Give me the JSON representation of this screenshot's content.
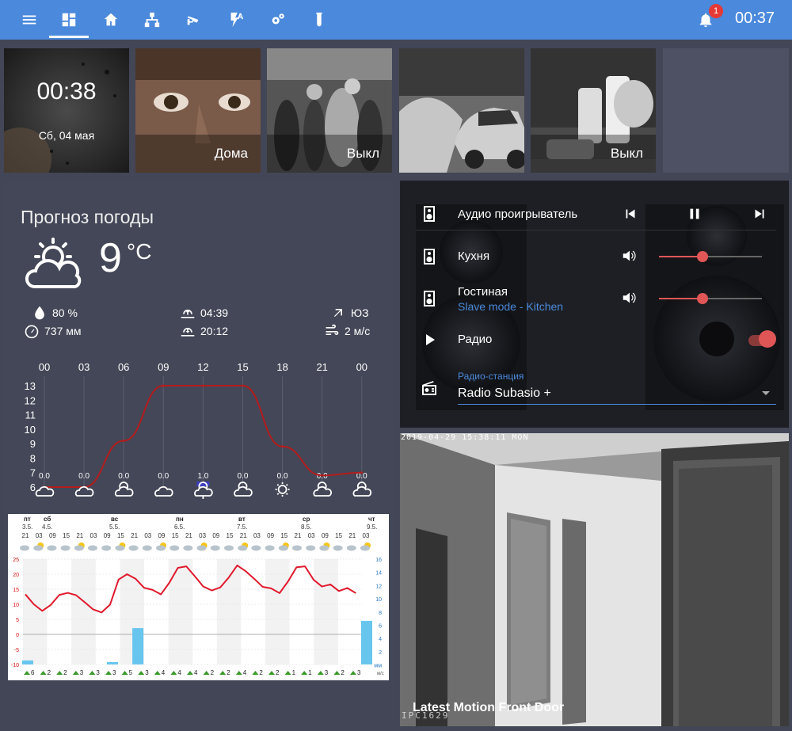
{
  "topbar": {
    "icons": [
      "menu-icon",
      "dashboard-icon",
      "home-icon",
      "network-icon",
      "cctv-icon",
      "flash-auto-icon",
      "settings-icon",
      "test-tube-icon"
    ],
    "notification_count": "1",
    "time": "00:37"
  },
  "tiles": [
    {
      "time": "00:38",
      "date": "Сб, 04 мая"
    },
    {
      "caption": "Дома"
    },
    {
      "caption": "Выкл"
    },
    {
      "caption": ""
    },
    {
      "caption": "Выкл"
    }
  ],
  "weather": {
    "title": "Прогноз погоды",
    "temp": "9",
    "unit": "°C",
    "humidity": "80 %",
    "pressure": "737 мм",
    "sunrise": "04:39",
    "sunset": "20:12",
    "wind_dir": "ЮЗ",
    "wind_speed": "2 м/с",
    "hours": [
      "00",
      "03",
      "06",
      "09",
      "12",
      "15",
      "18",
      "21",
      "00"
    ],
    "y_ticks": [
      "13",
      "12",
      "11",
      "10",
      "9",
      "8",
      "7",
      "6"
    ],
    "precip": [
      "0.0",
      "0.0",
      "0.0",
      "0.0",
      "1.0",
      "0.0",
      "0.0",
      "0.0",
      "0.0"
    ],
    "forecast_icons": [
      "cloudy-icon",
      "cloudy-icon",
      "partly-cloudy-icon",
      "cloudy-icon",
      "rain-icon",
      "partly-cloudy-icon",
      "sunny-icon",
      "partly-cloudy-icon",
      "partly-cloudy-icon"
    ]
  },
  "chart_data": {
    "type": "line",
    "x": [
      "00",
      "03",
      "06",
      "09",
      "12",
      "15",
      "18",
      "21",
      "00"
    ],
    "series": [
      {
        "values": [
          6,
          6,
          9.2,
          13,
          13,
          13,
          8.8,
          6.8,
          7
        ]
      }
    ],
    "bars": [
      0,
      0,
      0,
      0,
      1.0,
      0,
      0,
      0,
      0
    ],
    "ylim": [
      6,
      13
    ],
    "grid": true
  },
  "meteogram": {
    "days": [
      "пт",
      "сб",
      "вс",
      "пн",
      "вт",
      "ср",
      "чт"
    ],
    "dates": [
      "3.5.",
      "4.5.",
      "5.5.",
      "6.5.",
      "7.5.",
      "8.5.",
      "9.5."
    ],
    "hours": [
      "21",
      "03",
      "09",
      "15",
      "21",
      "03",
      "09",
      "15",
      "21",
      "03",
      "09",
      "15",
      "21",
      "03",
      "09",
      "15",
      "21",
      "03",
      "09",
      "15",
      "21",
      "03",
      "09",
      "15",
      "21",
      "03"
    ],
    "left_ticks": [
      "25",
      "20",
      "15",
      "10",
      "5",
      "0",
      "-5",
      "-10"
    ],
    "right_ticks": [
      "16",
      "14",
      "12",
      "10",
      "8",
      "6",
      "4",
      "2",
      "мм"
    ],
    "winds": [
      "6",
      "2",
      "2",
      "3",
      "3",
      "3",
      "5",
      "3",
      "4",
      "4",
      "4",
      "2",
      "2",
      "4",
      "2",
      "2",
      "1",
      "1",
      "3",
      "2",
      "3"
    ],
    "wind_unit": "м/с",
    "temps": [
      13.3,
      10,
      7.8,
      9.8,
      13.1,
      13.8,
      13,
      10.7,
      8.3,
      7.3,
      9.9,
      18.2,
      20,
      18.5,
      15.5,
      14.8,
      13.3,
      17.2,
      22.1,
      22.6,
      19.3,
      15.9,
      14.6,
      15.6,
      18.9,
      22.9,
      21,
      18.5,
      15.8,
      15.3,
      13.7,
      17.6,
      22.3,
      22.6,
      18.2,
      15.9,
      16.6,
      14.4,
      15.4,
      13.7
    ],
    "precip_mm": [
      {
        "i": 0,
        "mm": 0.5
      },
      {
        "i": 10,
        "mm": 0.3
      },
      {
        "i": 13,
        "mm": 4.5
      },
      {
        "i": 40,
        "mm": 5.4
      }
    ]
  },
  "media": {
    "player_label": "Аудио проигрыватель",
    "kitchen_label": "Кухня",
    "kitchen_volume": 0.42,
    "living_label": "Гостиная",
    "living_sub": "Slave mode - Kitchen",
    "living_volume": 0.42,
    "radio_label": "Радио",
    "radio_on": true,
    "station_label": "Радио-станция",
    "station_value": "Radio Subasio +"
  },
  "camera": {
    "timestamp": "2019-04-29 15:38:11 MON",
    "title": "Latest Motion Front Door",
    "ipc_label": "IPC1629"
  }
}
